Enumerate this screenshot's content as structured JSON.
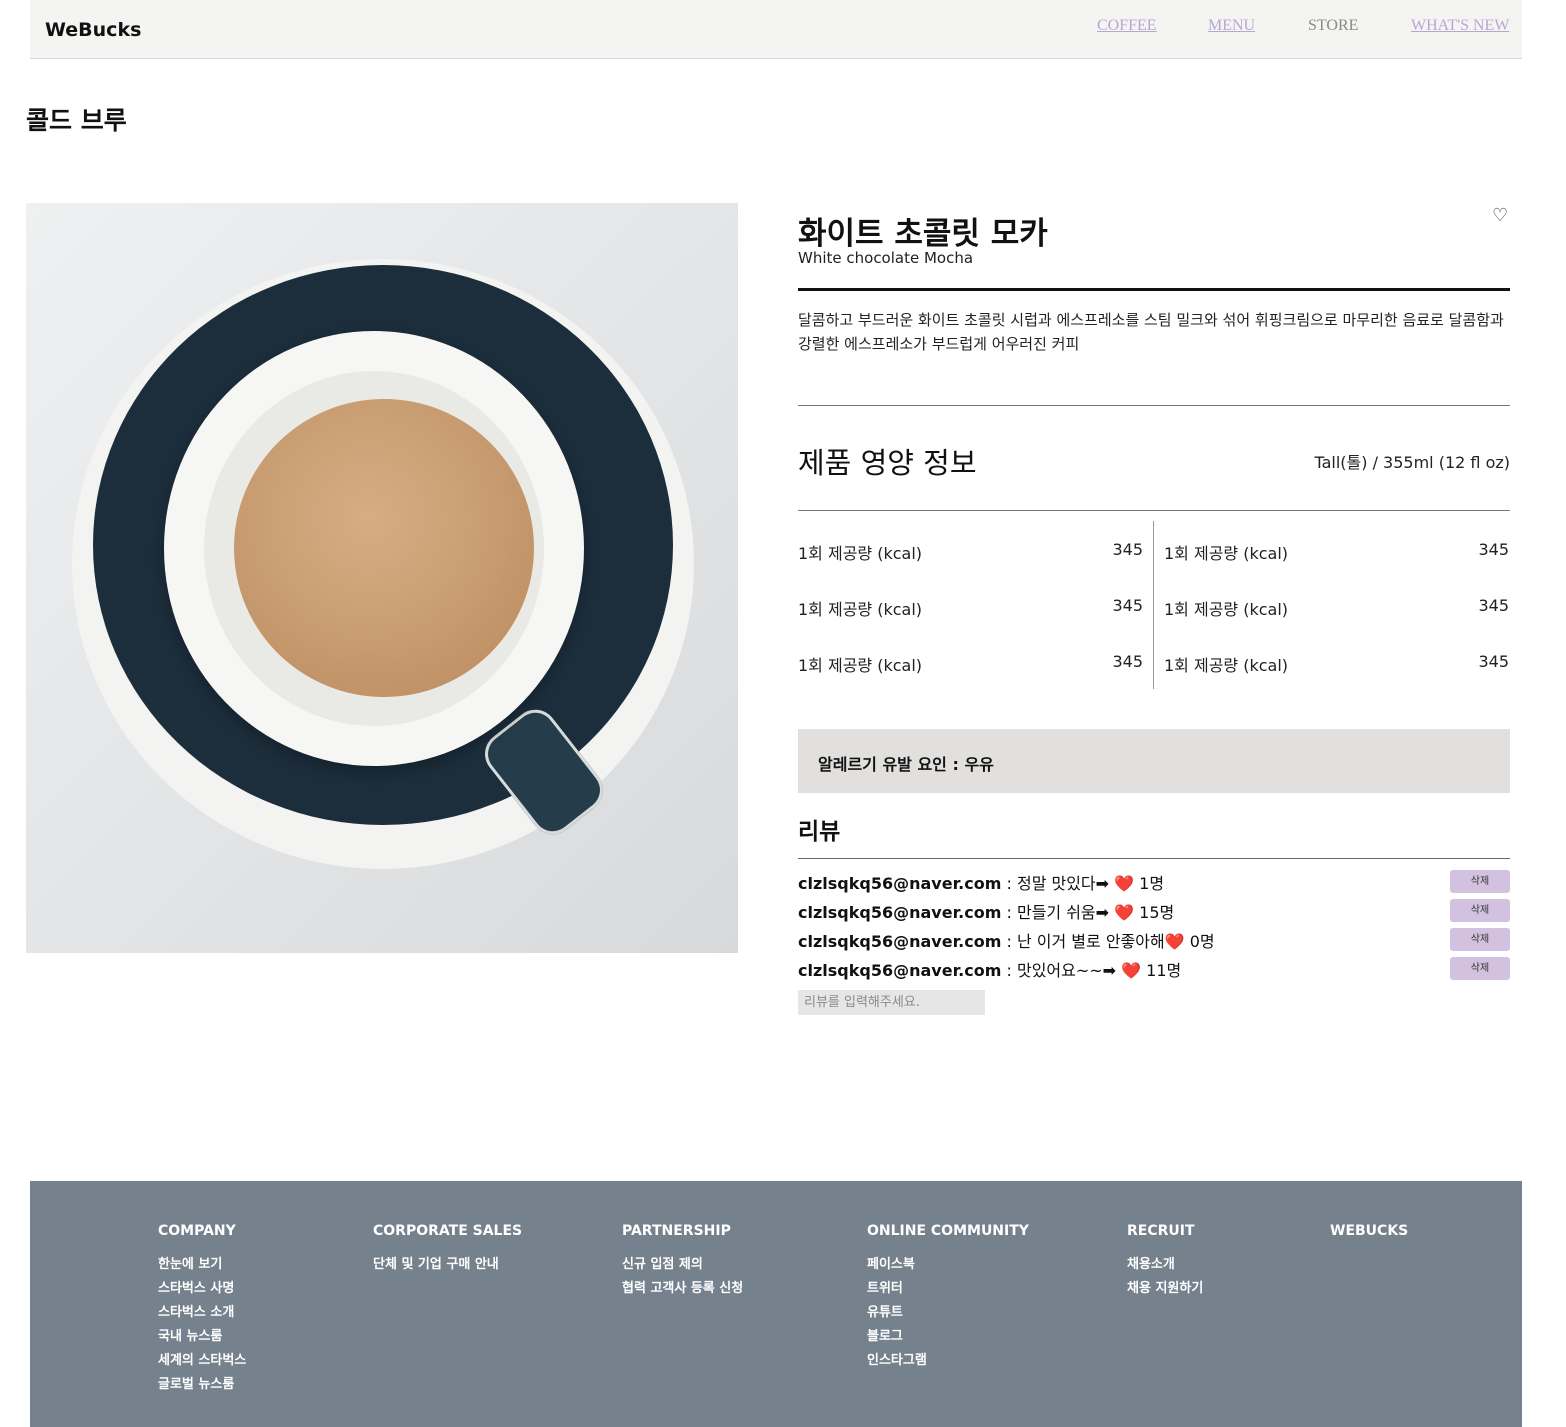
{
  "nav": {
    "brand": "WeBucks",
    "links": [
      {
        "label": "COFFEE",
        "style": "visited"
      },
      {
        "label": "MENU",
        "style": "visited"
      },
      {
        "label": "STORE",
        "style": "plain"
      },
      {
        "label": "WHAT'S NEW",
        "style": "visited"
      }
    ]
  },
  "category": "콜드 브루",
  "product": {
    "title_ko": "화이트 초콜릿 모카",
    "title_en": "White chocolate Mocha",
    "like_icon": "♡",
    "description": "달콤하고 부드러운 화이트 초콜릿 시럽과 에스프레소를 스팀 밀크와 섞어 휘핑크림으로 마무리한 음료로 달콤함과 강렬한 에스프레소가 부드럽게 어우러진 커피"
  },
  "nutrition": {
    "heading": "제품 영양 정보",
    "size": "Tall(톨) / 355ml (12 fl oz)",
    "rows": [
      {
        "label": "1회 제공량 (kcal)",
        "value": "345"
      },
      {
        "label": "1회 제공량 (kcal)",
        "value": "345"
      },
      {
        "label": "1회 제공량 (kcal)",
        "value": "345"
      },
      {
        "label": "1회 제공량 (kcal)",
        "value": "345"
      },
      {
        "label": "1회 제공량 (kcal)",
        "value": "345"
      },
      {
        "label": "1회 제공량 (kcal)",
        "value": "345"
      }
    ]
  },
  "allergy": "알레르기 유발 요인 : 우유",
  "reviews": {
    "heading": "리뷰",
    "items": [
      {
        "email": "clzlsqkq56@naver.com",
        "text": " : 정말 맛있다➡ ❤️ 1명",
        "delete": "삭제"
      },
      {
        "email": "clzlsqkq56@naver.com",
        "text": " : 만들기 쉬움➡ ❤️ 15명",
        "delete": "삭제"
      },
      {
        "email": "clzlsqkq56@naver.com",
        "text": " : 난 이거 별로 안좋아해❤️ 0명",
        "delete": "삭제"
      },
      {
        "email": "clzlsqkq56@naver.com",
        "text": " : 맛있어요~~➡ ❤️ 11명",
        "delete": "삭제"
      }
    ],
    "input_placeholder": "리뷰를 입력해주세요."
  },
  "footer": {
    "columns": [
      {
        "heading": "COMPANY",
        "items": [
          "한눈에 보기",
          "스타벅스 사명",
          "스타벅스 소개",
          "국내 뉴스룸",
          "세계의 스타벅스",
          "글로벌 뉴스룸"
        ]
      },
      {
        "heading": "CORPORATE SALES",
        "items": [
          "단체 및 기업 구매 안내"
        ]
      },
      {
        "heading": "PARTNERSHIP",
        "items": [
          "신규 입점 제의",
          "협력 고객사 등록 신청"
        ]
      },
      {
        "heading": "ONLINE COMMUNITY",
        "items": [
          "페이스북",
          "트위터",
          "유튜트",
          "블로그",
          "인스타그램"
        ]
      },
      {
        "heading": "RECRUIT",
        "items": [
          "채용소개",
          "채용 지원하기"
        ]
      },
      {
        "heading": "WEBUCKS",
        "items": []
      }
    ]
  }
}
